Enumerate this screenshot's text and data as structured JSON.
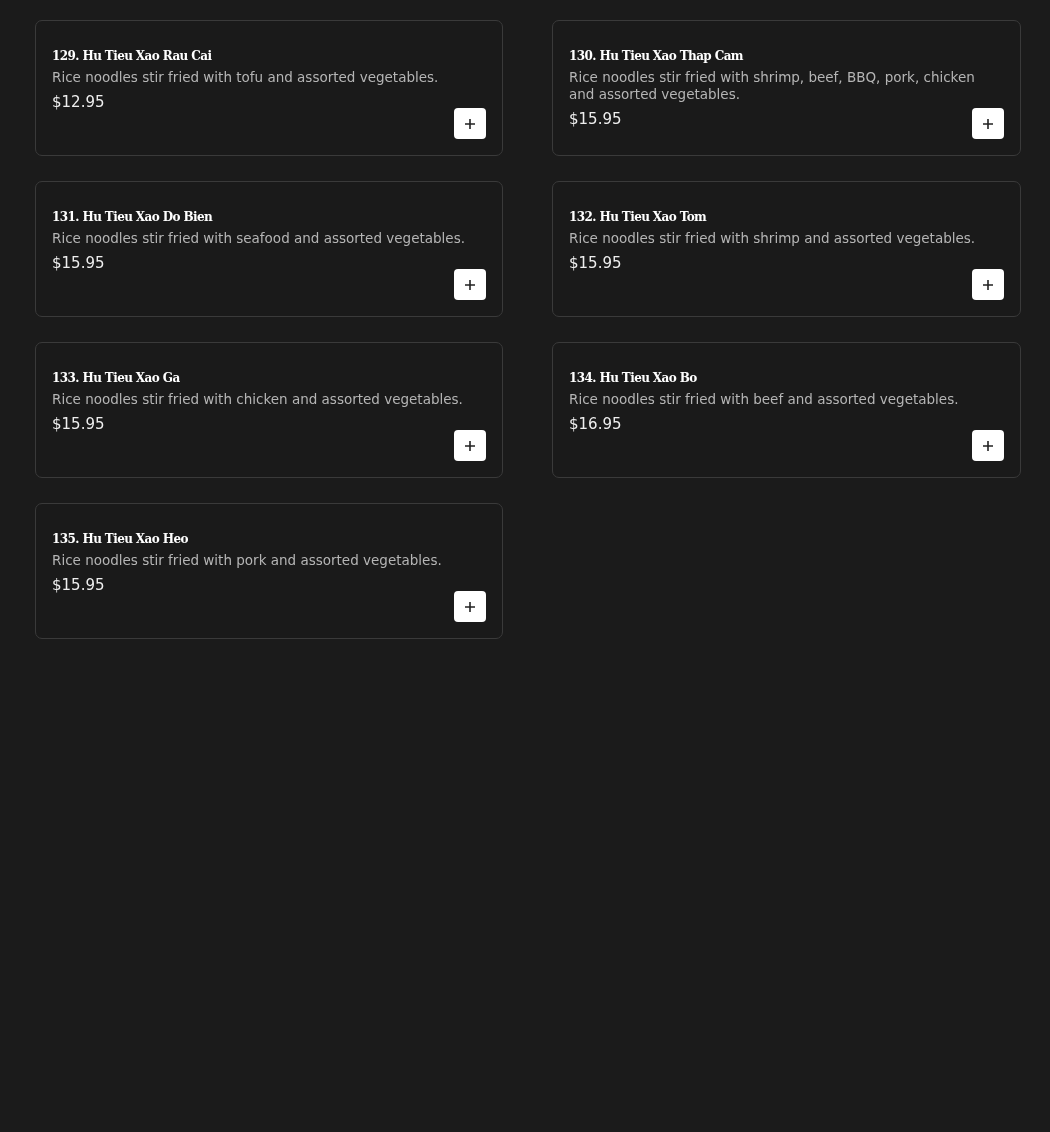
{
  "menu_items": [
    {
      "name": "129. Hu Tieu Xao Rau Cai",
      "description": "Rice noodles stir fried with tofu and assorted vegetables.",
      "price": "$12.95"
    },
    {
      "name": "130. Hu Tieu Xao Thap Cam",
      "description": "Rice noodles stir fried with shrimp, beef, BBQ, pork, chicken and assorted vegetables.",
      "price": "$15.95"
    },
    {
      "name": "131. Hu Tieu Xao Do Bien",
      "description": "Rice noodles stir fried with seafood and assorted vegetables.",
      "price": "$15.95"
    },
    {
      "name": "132. Hu Tieu Xao Tom",
      "description": "Rice noodles stir fried with shrimp and assorted vegetables.",
      "price": "$15.95"
    },
    {
      "name": "133. Hu Tieu Xao Ga",
      "description": "Rice noodles stir fried with chicken and assorted vegetables.",
      "price": "$15.95"
    },
    {
      "name": "134. Hu Tieu Xao Bo",
      "description": "Rice noodles stir fried with beef and assorted vegetables.",
      "price": "$16.95"
    },
    {
      "name": "135. Hu Tieu Xao Heo",
      "description": "Rice noodles stir fried with pork and assorted vegetables.",
      "price": "$15.95"
    }
  ]
}
